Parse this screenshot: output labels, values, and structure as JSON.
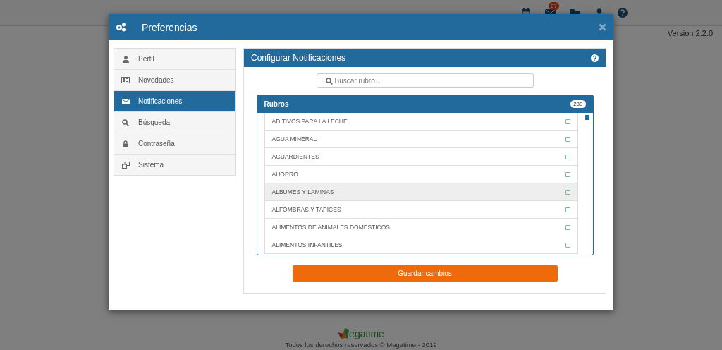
{
  "top_bar": {
    "notification_count": "27",
    "version": "Version 2.2.0"
  },
  "modal": {
    "title": "Preferencias"
  },
  "sidebar": {
    "items": [
      {
        "label": "Perfil",
        "selected": false
      },
      {
        "label": "Novedades",
        "selected": false
      },
      {
        "label": "Notificaciones",
        "selected": true
      },
      {
        "label": "Búsqueda",
        "selected": false
      },
      {
        "label": "Contraseña",
        "selected": false
      },
      {
        "label": "Sistema",
        "selected": false
      }
    ]
  },
  "panel": {
    "title": "Configurar Notificaciones",
    "search": {
      "placeholder": "Buscar rubro..."
    },
    "list": {
      "title": "Rubros",
      "count": "280",
      "items": [
        {
          "label": "ADITIVOS PARA LA LECHE",
          "checked": false,
          "highlighted": false
        },
        {
          "label": "AGUA MINERAL",
          "checked": false,
          "highlighted": false
        },
        {
          "label": "AGUARDIENTES",
          "checked": false,
          "highlighted": false
        },
        {
          "label": "AHORRO",
          "checked": false,
          "highlighted": false
        },
        {
          "label": "ALBUMES Y LAMINAS",
          "checked": false,
          "highlighted": true
        },
        {
          "label": "ALFOMBRAS Y TAPICES",
          "checked": false,
          "highlighted": false
        },
        {
          "label": "ALIMENTOS DE ANIMALES DOMESTICOS",
          "checked": false,
          "highlighted": false
        },
        {
          "label": "ALIMENTOS INFANTILES",
          "checked": false,
          "highlighted": false
        }
      ]
    },
    "save_button": "Guardar cambios"
  },
  "footer": {
    "wordmark": "egatime",
    "copyright": "Todos los derechos reservados © Megatime - 2019"
  }
}
